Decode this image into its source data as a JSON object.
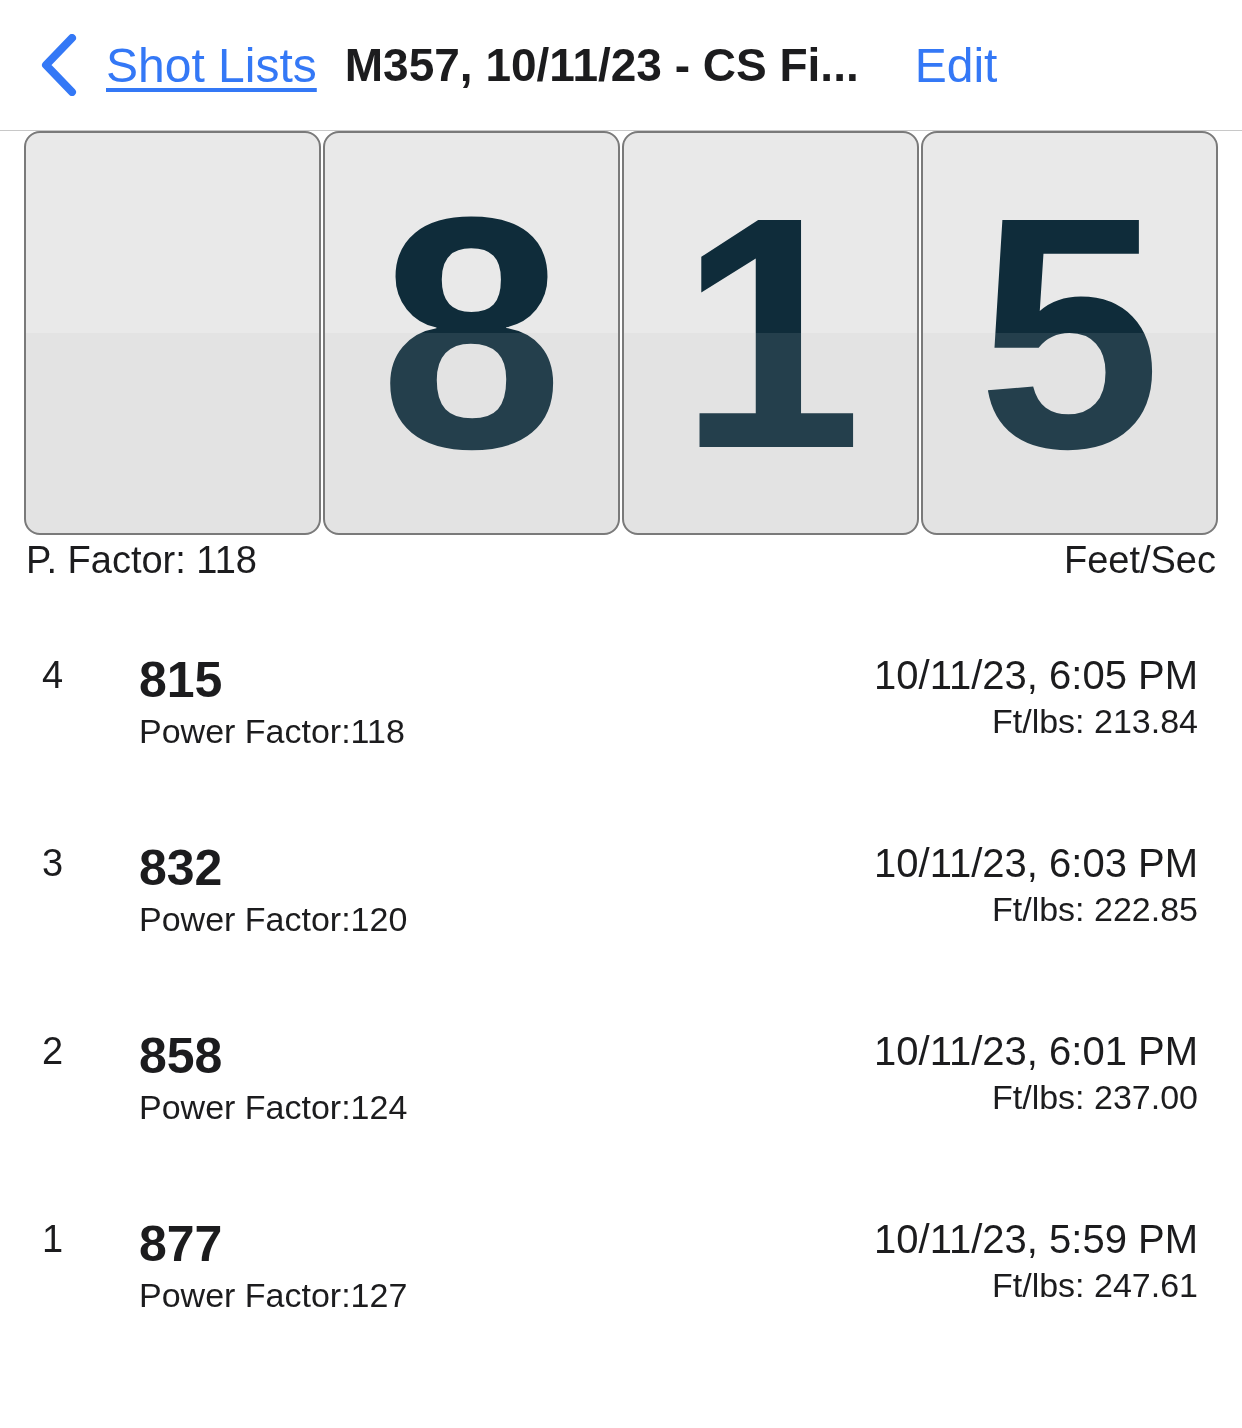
{
  "nav": {
    "back_label": "Shot Lists",
    "title": "M357, 10/11/23 - CS Fi...",
    "action": "Edit"
  },
  "display": {
    "cards": [
      {
        "kind": "blank"
      },
      {
        "kind": "digit",
        "digit": "8"
      },
      {
        "kind": "digit",
        "digit": "1"
      },
      {
        "kind": "digit",
        "digit": "5"
      }
    ],
    "left_caption": "P. Factor: 118",
    "right_caption": "Feet/Sec"
  },
  "shots": [
    {
      "number": "4",
      "speed": "815",
      "power_factor": "Power Factor:118",
      "time": "10/11/23, 6:05 PM",
      "energy": "Ft/lbs: 213.84"
    },
    {
      "number": "3",
      "speed": "832",
      "power_factor": "Power Factor:120",
      "time": "10/11/23, 6:03 PM",
      "energy": "Ft/lbs: 222.85"
    },
    {
      "number": "2",
      "speed": "858",
      "power_factor": "Power Factor:124",
      "time": "10/11/23, 6:01 PM",
      "energy": "Ft/lbs: 237.00"
    },
    {
      "number": "1",
      "speed": "877",
      "power_factor": "Power Factor:127",
      "time": "10/11/23, 5:59 PM",
      "energy": "Ft/lbs: 247.61"
    }
  ]
}
